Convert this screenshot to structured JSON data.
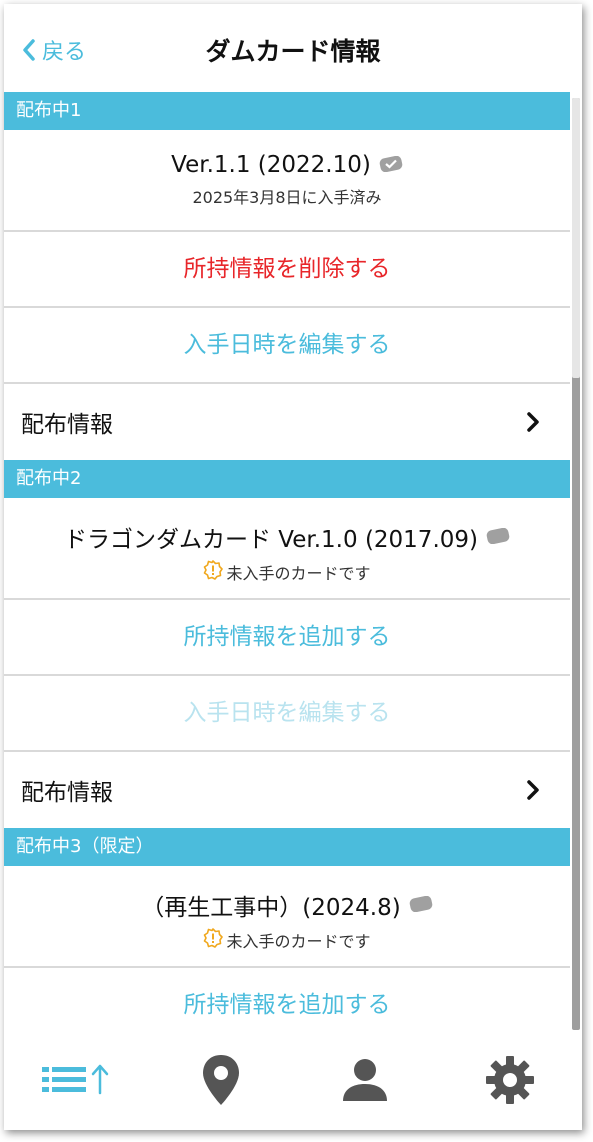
{
  "header": {
    "back_label": "戻る",
    "title": "ダムカード情報"
  },
  "sections": [
    {
      "header": "配布中1",
      "card_title": "Ver.1.1 (2022.10)",
      "card_status": "2025年3月8日に入手済み",
      "primary_action": "所持情報を削除する",
      "secondary_action": "入手日時を編集する",
      "nav_label": "配布情報"
    },
    {
      "header": "配布中2",
      "card_title": "ドラゴンダムカード Ver.1.0 (2017.09)",
      "card_status": "未入手のカードです",
      "primary_action": "所持情報を追加する",
      "secondary_action": "入手日時を編集する",
      "nav_label": "配布情報"
    },
    {
      "header": "配布中3（限定）",
      "card_title": "（再生工事中）(2024.8)",
      "card_status": "未入手のカードです",
      "primary_action": "所持情報を追加する"
    }
  ],
  "colors": {
    "accent": "#4bbcdc",
    "danger": "#e8262a",
    "disabled": "#b9e3ef",
    "tab_inactive": "#555555"
  },
  "tabs": [
    {
      "icon": "list-sort-icon",
      "active": true
    },
    {
      "icon": "map-pin-icon",
      "active": false
    },
    {
      "icon": "user-icon",
      "active": false
    },
    {
      "icon": "gear-icon",
      "active": false
    }
  ]
}
